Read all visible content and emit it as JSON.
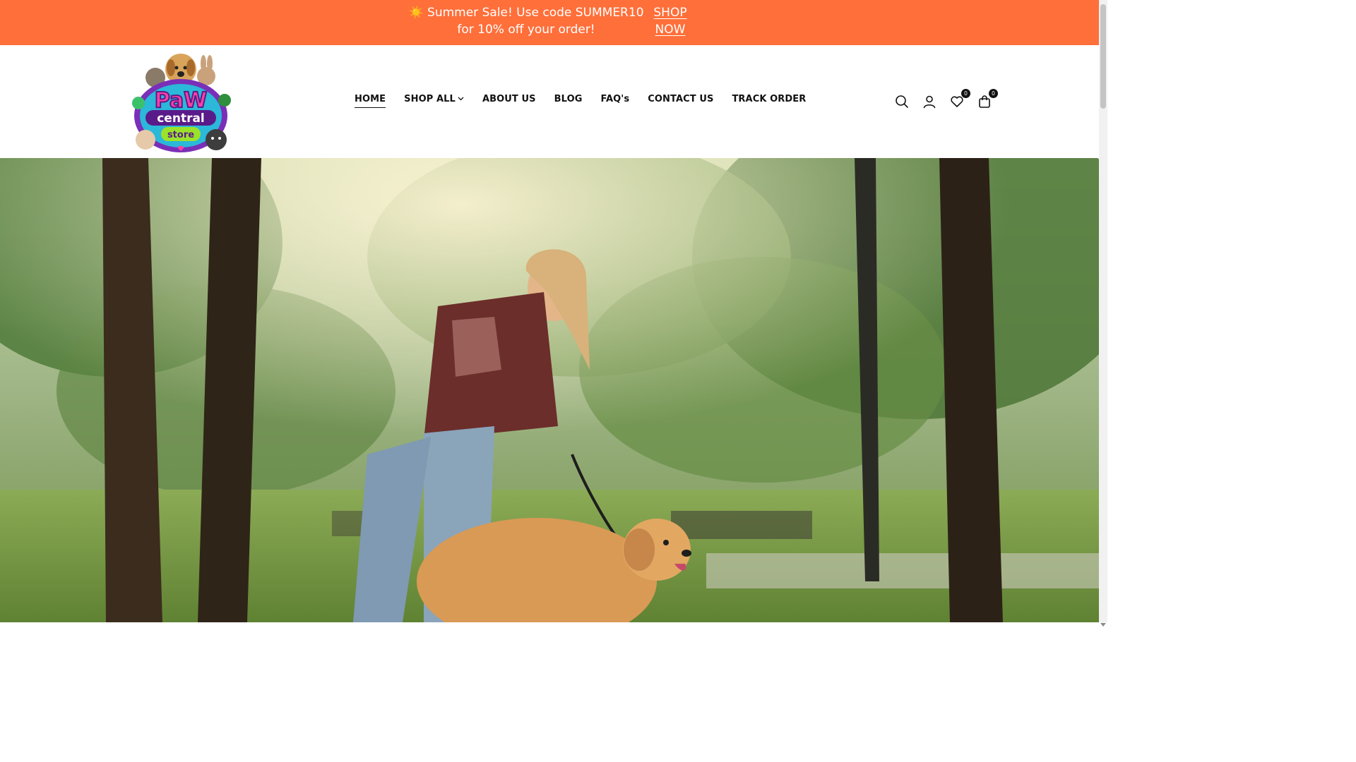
{
  "announcement": {
    "text": "☀️ Summer Sale! Use code SUMMER10 for 10% off your order!",
    "link": "SHOP NOW"
  },
  "brand": {
    "logo_words": [
      "Paw",
      "central",
      "store"
    ]
  },
  "nav": {
    "items": [
      {
        "label": "HOME",
        "active": true
      },
      {
        "label": "SHOP ALL",
        "dropdown": true
      },
      {
        "label": "ABOUT US"
      },
      {
        "label": "BLOG"
      },
      {
        "label": "FAQ's"
      },
      {
        "label": "CONTACT US"
      },
      {
        "label": "TRACK ORDER"
      }
    ]
  },
  "header_icons": {
    "search": "search-icon",
    "account": "account-icon",
    "wishlist": "heart-icon",
    "wishlist_count": "0",
    "cart": "cart-icon",
    "cart_count": "0"
  },
  "colors": {
    "announcement_bg": "#ff6f3a",
    "text": "#111111"
  }
}
